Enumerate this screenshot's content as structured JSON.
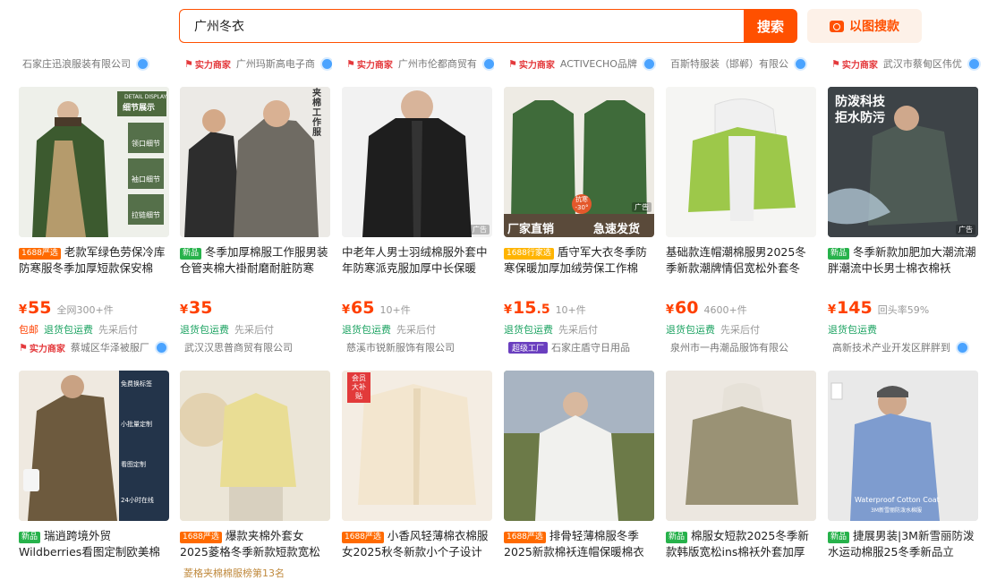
{
  "search": {
    "value": "广州冬衣",
    "button": "搜索",
    "image_button": "以图搜款"
  },
  "top_stores": [
    {
      "name": "石家庄迅浪服装有限公司",
      "tag": ""
    },
    {
      "name": "广州玛斯高电子商",
      "tag": "实力商家"
    },
    {
      "name": "广州市伦都商贸有",
      "tag": "实力商家"
    },
    {
      "name": "ACTIVECHO品牌",
      "tag": "实力商家"
    },
    {
      "name": "百斯特服装（邯郸）有限公",
      "tag": ""
    },
    {
      "name": "武汉市蔡甸区伟优",
      "tag": "实力商家"
    }
  ],
  "row1": [
    {
      "badge": "1688严选",
      "title": "老款军绿色劳保冷库防寒服冬季加厚短款保安棉",
      "price_int": "55",
      "price_dec": "",
      "sold": "全网300+件",
      "tags": [
        "包邮",
        "退货包运费",
        "先采后付"
      ],
      "store_tag": "实力商家",
      "store": "蔡城区华泽被服厂"
    },
    {
      "badge": "新品",
      "title": "冬季加厚棉服工作服男装仓管夹棉大褂耐磨耐脏防寒",
      "price_int": "35",
      "price_dec": "",
      "sold": "",
      "tags": [
        "",
        "退货包运费",
        "先采后付"
      ],
      "store_tag": "",
      "store": "武汉汉思普商贸有限公司"
    },
    {
      "badge": "",
      "title": "中老年人男士羽绒棉服外套中年防寒派克服加厚中长保暖",
      "price_int": "65",
      "price_dec": "",
      "sold": "10+件",
      "tags": [
        "",
        "退货包运费",
        "先采后付"
      ],
      "store_tag": "",
      "store": "慈溪市锐新服饰有限公司"
    },
    {
      "badge": "1688行家选",
      "title": "盾守军大衣冬季防寒保暖加厚加绒劳保工作棉",
      "price_int": "15",
      "price_dec": ".5",
      "sold": "10+件",
      "tags": [
        "",
        "退货包运费",
        "先采后付"
      ],
      "store_tag": "超级工厂",
      "store": "石家庄盾守日用品"
    },
    {
      "badge": "",
      "title": "基础款连帽潮棉服男2025冬季新款潮牌情侣宽松外套冬",
      "price_int": "60",
      "price_dec": "",
      "sold": "4600+件",
      "tags": [
        "",
        "退货包运费",
        "先采后付"
      ],
      "store_tag": "",
      "store": "泉州市一冉潮品服饰有限公"
    },
    {
      "badge": "新品",
      "title": "冬季新款加肥加大潮流潮胖潮流中长男士棉衣棉袄",
      "price_int": "145",
      "price_dec": "",
      "sold": "回头率59%",
      "tags": [
        "",
        "退货包运费",
        ""
      ],
      "store_tag": "",
      "store": "高新技术产业开发区胖胖到"
    }
  ],
  "row2": [
    {
      "badge": "新品",
      "title": "瑞逍跨境外贸Wildberries看图定制欧美棉服外套包"
    },
    {
      "badge": "1688严选",
      "title": "爆款夹棉外套女2025菱格冬季新款短款宽松时"
    },
    {
      "badge": "1688严选",
      "title": "小香风轻薄棉衣棉服女2025秋冬新款小个子设计"
    },
    {
      "badge": "1688严选",
      "title": "排骨轻薄棉服冬季2025新款棉袄连帽保暖棉衣棉"
    },
    {
      "badge": "新品",
      "title": "棉服女短款2025冬季新款韩版宽松ins棉袄外套加厚"
    },
    {
      "badge": "新品",
      "title": "捷展男装|3M新雪丽防泼水运动棉服25冬季新品立"
    }
  ],
  "bottom_note": "菱格夹棉棉服榜第13名",
  "overlays": {
    "p1": [
      "DETAIL DISPLAY",
      "细节展示",
      "领口细节",
      "袖口细节",
      "拉链细节"
    ],
    "p2": [
      "夹棉工作服"
    ],
    "p4": [
      "厂家直销",
      "抗寒",
      "-30°",
      "急速发货"
    ],
    "p6": [
      "防泼科技",
      "拒水防污"
    ],
    "q1": [
      "免费换标签",
      "小批量定制",
      "看图定制",
      "24小时在线"
    ],
    "q2": [
      "会员",
      "大补贴"
    ],
    "q3": [
      "会员",
      "大补贴"
    ],
    "q6": [
      "Waterproof Cotton Coat",
      "3M新雪丽防泼水棉服"
    ]
  },
  "ad_label": "广告",
  "price_symbol": "¥",
  "colors": {
    "accent": "#ff5000"
  }
}
